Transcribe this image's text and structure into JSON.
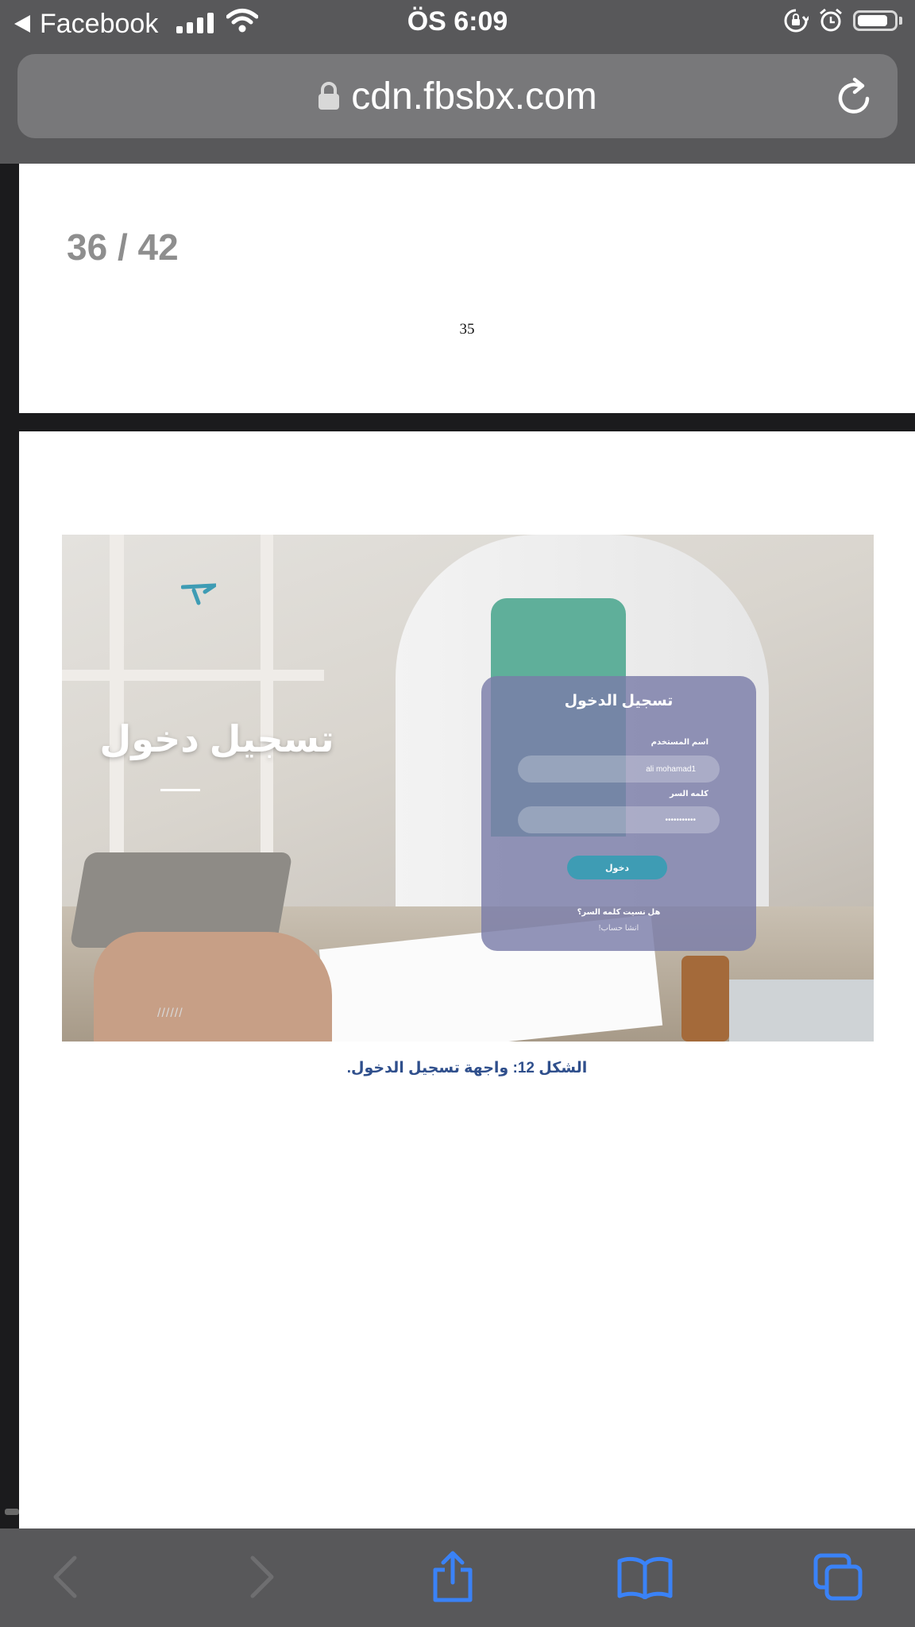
{
  "status_bar": {
    "back_app": "Facebook",
    "time": "ÖS 6:09",
    "battery_level": 0.85
  },
  "url_bar": {
    "domain": "cdn.fbsbx.com"
  },
  "document": {
    "page_counter": "36 / 42",
    "page1_number": "35",
    "figure": {
      "big_title": "تسجيل دخول",
      "hash_mark": "//////",
      "login_card": {
        "title": "تسجيل الدخول",
        "username_label": "اسم المستخدم",
        "username_value": "ali mohamad1",
        "password_label": "كلمه السر",
        "password_value": "•••••••••••",
        "login_button": "دخول",
        "forgot_password": "هل نسيت كلمه السر؟",
        "create_account": "انشا حساب!"
      }
    },
    "caption": "الشكل 12: واجهة تسجيل الدخول."
  },
  "colors": {
    "chrome": "#58585a",
    "url_field": "#78787a",
    "toolbar_icons": "#3a82f7",
    "caption": "#2f4f8c",
    "login_button": "#3e9cb4"
  }
}
